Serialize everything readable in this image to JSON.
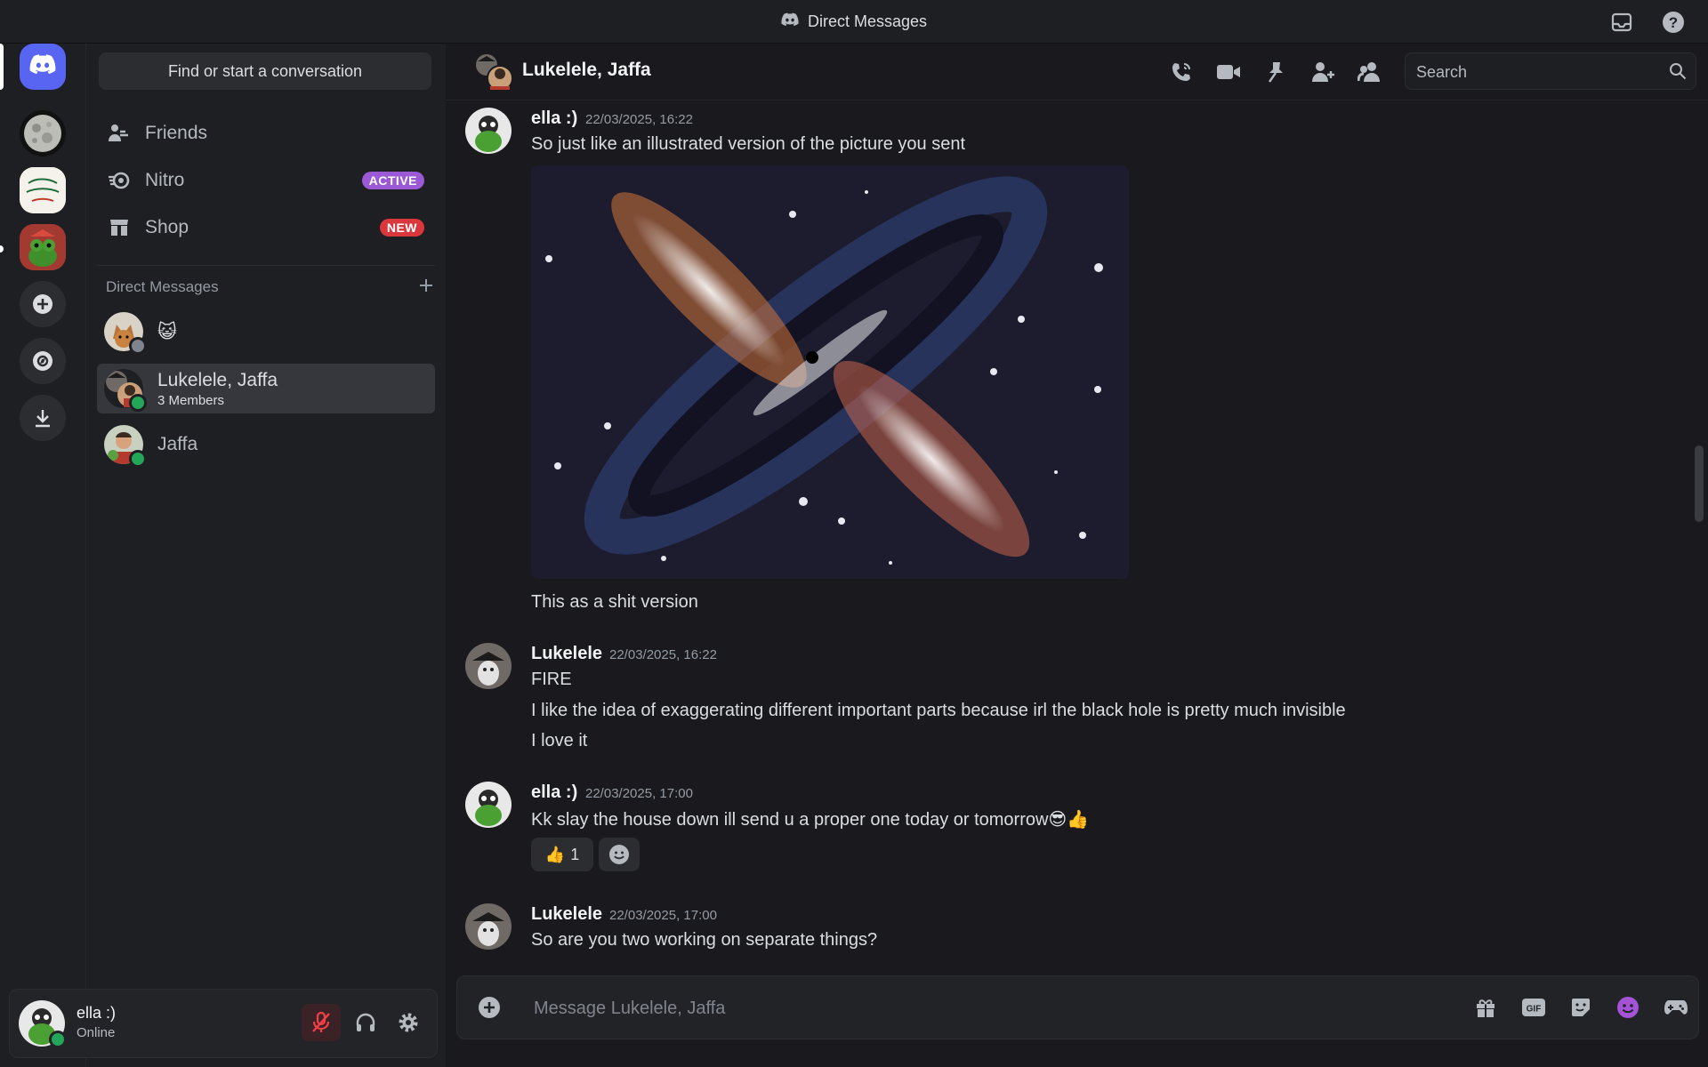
{
  "titlebar": {
    "title": "Direct Messages"
  },
  "sidebar": {
    "search_label": "Find or start a conversation",
    "nav": [
      {
        "label": "Friends"
      },
      {
        "label": "Nitro",
        "badge": "ACTIVE"
      },
      {
        "label": "Shop",
        "badge": "NEW"
      }
    ],
    "dm_header": "Direct Messages",
    "dms": [
      {
        "name": "😺",
        "sub": ""
      },
      {
        "name": "Lukelele, Jaffa",
        "sub": "3 Members"
      },
      {
        "name": "Jaffa",
        "sub": ""
      }
    ]
  },
  "user": {
    "name": "ella :)",
    "status": "Online"
  },
  "chat": {
    "channel_name": "Lukelele, Jaffa",
    "search_placeholder": "Search",
    "composer_placeholder": "Message Lukelele, Jaffa",
    "messages": [
      {
        "author": "ella :)",
        "time": "22/03/2025, 16:22",
        "lines": [
          "So just like an illustrated version of the picture you sent",
          "This as a shit version"
        ]
      },
      {
        "author": "Lukelele",
        "time": "22/03/2025, 16:22",
        "lines": [
          "FIRE",
          "I like the idea of exaggerating different important parts because irl the black hole is pretty much invisible",
          "I love it"
        ]
      },
      {
        "author": "ella :)",
        "time": "22/03/2025, 17:00",
        "lines": [
          "Kk slay the house down ill send u a proper one today or tomorrow😎👍"
        ],
        "reaction": {
          "emoji": "👍",
          "count": "1"
        }
      },
      {
        "author": "Lukelele",
        "time": "22/03/2025, 17:00",
        "lines": [
          "So are you two working on separate things?"
        ]
      }
    ]
  },
  "colors": {
    "accent": "#5865f2",
    "online": "#23a55a",
    "nitro_badge": "#9b59d6",
    "new_badge": "#da373c",
    "mute_red": "#f23f43"
  }
}
